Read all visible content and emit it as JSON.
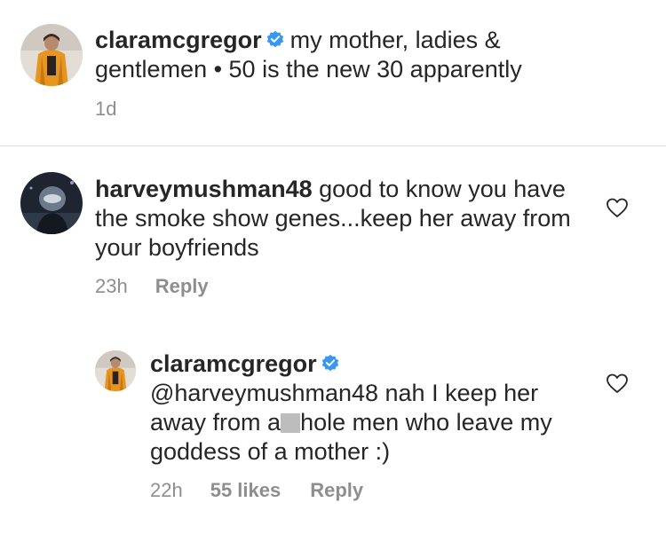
{
  "caption": {
    "username": "claramcgregor",
    "text": "my mother, ladies & gentlemen • 50 is the new 30 apparently",
    "time": "1d"
  },
  "comments": [
    {
      "username": "harveymushman48",
      "text": "good to know you have the smoke show genes...keep her away from your boyfriends",
      "time": "23h",
      "reply_label": "Reply"
    }
  ],
  "reply": {
    "username": "claramcgregor",
    "text_before": "@harveymushman48 nah I keep her away from a",
    "text_after": "hole men who leave my goddess of a mother :)",
    "time": "22h",
    "likes": "55 likes",
    "reply_label": "Reply"
  },
  "colors": {
    "verified_badge": "#3897f0",
    "secondary_text": "#8e8e8e",
    "jacket_orange": "#e6951f"
  },
  "icons": {
    "verified": "verified-badge-icon",
    "like": "heart-outline-icon"
  }
}
